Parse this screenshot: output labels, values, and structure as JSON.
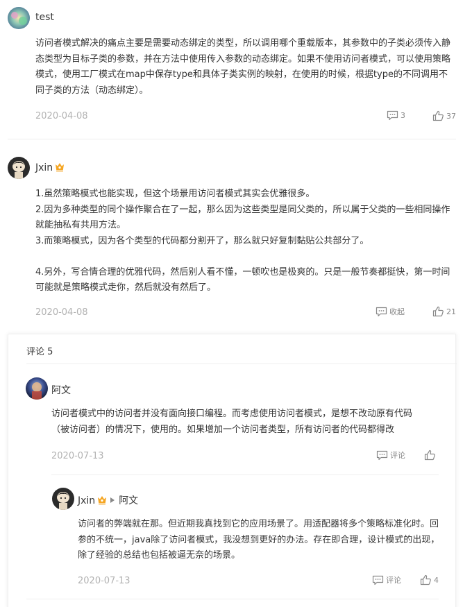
{
  "comments": [
    {
      "user": "test",
      "content": "访问者模式解决的痛点主要是需要动态绑定的类型，所以调用哪个重载版本，其参数中的子类必须传入静态类型为目标子类的参数，并在方法中使用传入参数的动态绑定。如果不使用访问者模式，可以使用策略模式，使用工厂模式在map中保存type和具体子类实例的映射，在使用的时候，根据type的不同调用不同子类的方法（动态绑定）。",
      "date": "2020-04-08",
      "comment_count": "3",
      "like_count": "37"
    },
    {
      "user": "Jxin",
      "content": "1.虽然策略模式也能实现，但这个场景用访问者模式其实会优雅很多。\n2.因为多种类型的同个操作聚合在了一起，那么因为这些类型是同父类的，所以属于父类的一些相同操作就能抽私有共用方法。\n3.而策略模式，因为各个类型的代码都分割开了，那么就只好复制黏贴公共部分了。\n\n4.另外，写合情合理的优雅代码，然后别人看不懂，一顿吹也是极爽的。只是一般节奏都挺快，第一时间可能就是策略模式走你，然后就没有然后了。",
      "date": "2020-04-08",
      "collapse_label": "收起",
      "like_count": "21"
    }
  ],
  "replies": {
    "header": "评论 5",
    "items": [
      {
        "user": "阿文",
        "content": "访问者模式中的访问者并没有面向接口编程。而考虑使用访问者模式，是想不改动原有代码（被访问者）的情况下，使用的。如果增加一个访问者类型，所有访问者的代码都得改",
        "date": "2020-07-13",
        "comment_label": "评论"
      },
      {
        "user": "Jxin",
        "reply_to": "阿文",
        "content": "访问者的弊端就在那。但近期我真找到它的应用场景了。用适配器将多个策略标准化时。回参的不统一，java除了访问者模式，我没想到更好的办法。存在即合理，设计模式的出现，除了经验的总结也包括被逼无奈的场景。",
        "date": "2020-07-13",
        "comment_label": "评论",
        "like_count": "4"
      }
    ]
  },
  "colors": {
    "text": "#353535",
    "muted": "#b2b2b2",
    "vip": "#f5a623"
  }
}
